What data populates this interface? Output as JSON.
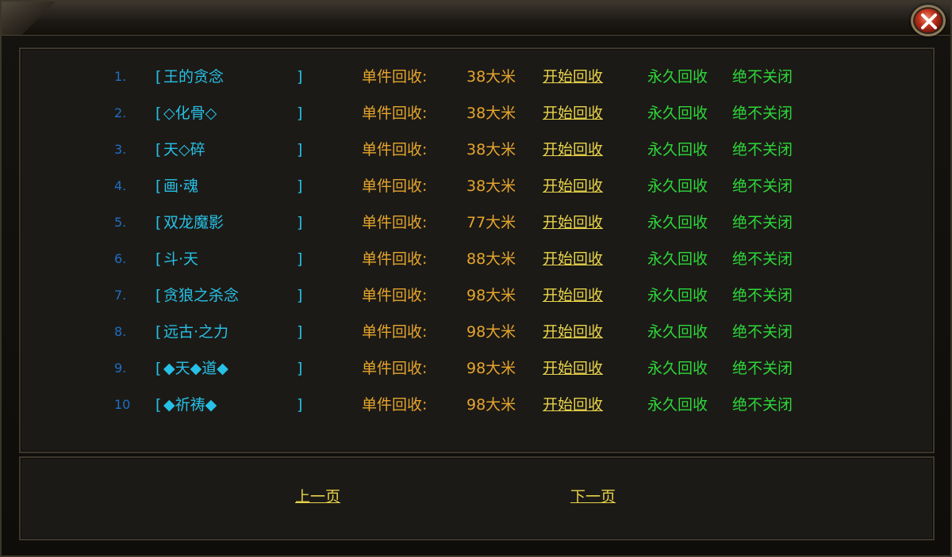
{
  "window": {
    "close_icon": "close-x-icon"
  },
  "labels": {
    "unit_price": "单件回收:",
    "action": "开始回收",
    "permanent": "永久回收",
    "never_close": "绝不关闭",
    "bracket_open": "[",
    "bracket_close": "]"
  },
  "items": [
    {
      "index": "1.",
      "name": "王的贪念",
      "price": "38大米"
    },
    {
      "index": "2.",
      "name": "◇化骨◇",
      "price": "38大米"
    },
    {
      "index": "3.",
      "name": "天◇碎",
      "price": "38大米"
    },
    {
      "index": "4.",
      "name": "画·魂",
      "price": "38大米"
    },
    {
      "index": "5.",
      "name": "双龙魔影",
      "price": "77大米"
    },
    {
      "index": "6.",
      "name": "斗·天",
      "price": "88大米"
    },
    {
      "index": "7.",
      "name": "贪狼之杀念",
      "price": "98大米"
    },
    {
      "index": "8.",
      "name": "远古·之力",
      "price": "98大米"
    },
    {
      "index": "9.",
      "name": "◆天◆道◆",
      "price": "98大米"
    },
    {
      "index": "10",
      "name": "◆祈祷◆",
      "price": "98大米"
    }
  ],
  "pagination": {
    "prev": "上一页",
    "next": "下一页"
  }
}
